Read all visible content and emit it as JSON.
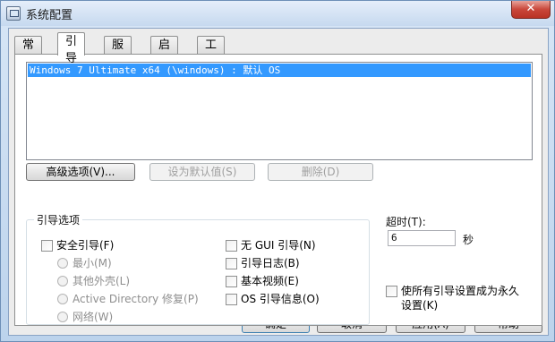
{
  "window": {
    "title": "系统配置",
    "close_glyph": "✕"
  },
  "tabs": [
    {
      "label": "常规"
    },
    {
      "label": "引导"
    },
    {
      "label": "服务"
    },
    {
      "label": "启动"
    },
    {
      "label": "工具"
    }
  ],
  "active_tab": "引导",
  "boot_list": {
    "items": [
      "Windows 7 Ultimate x64 (\\windows) : 默认 OS"
    ]
  },
  "buttons": {
    "advanced": "高级选项(V)...",
    "set_default": "设为默认值(S)",
    "delete": "删除(D)"
  },
  "boot_options": {
    "legend": "引导选项",
    "safe_boot": "安全引导(F)",
    "minimal": "最小(M)",
    "alternate_shell": "其他外壳(L)",
    "active_directory": "Active Directory 修复(P)",
    "network": "网络(W)",
    "no_gui": "无 GUI 引导(N)",
    "boot_log": "引导日志(B)",
    "base_video": "基本视频(E)",
    "os_boot_info": "OS 引导信息(O)"
  },
  "timeout": {
    "label": "超时(T):",
    "value": "6",
    "unit": "秒"
  },
  "permanent": {
    "label_line1": "使所有引导设置成为永久",
    "label_line2": "设置(K)"
  },
  "footer": {
    "ok": "确定",
    "cancel": "取消",
    "apply": "应用(A)",
    "help": "帮助"
  }
}
